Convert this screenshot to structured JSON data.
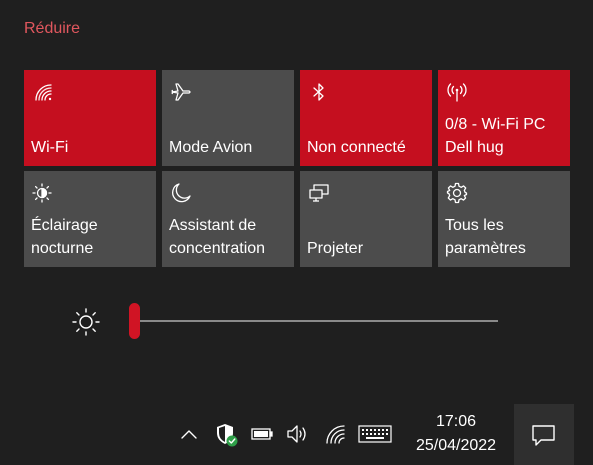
{
  "header": {
    "collapse_label": "Réduire"
  },
  "tiles": [
    {
      "label": "Wi-Fi",
      "icon": "wifi-icon",
      "active": true
    },
    {
      "label": "Mode Avion",
      "icon": "airplane-icon",
      "active": false
    },
    {
      "label": "Non connecté",
      "icon": "bluetooth-icon",
      "active": true
    },
    {
      "label": "0/8 - Wi-Fi PC\nDell hug",
      "icon": "hotspot-icon",
      "active": true
    },
    {
      "label": "Éclairage\nnocturne",
      "icon": "night-light-icon",
      "active": false
    },
    {
      "label": "Assistant de\nconcentration",
      "icon": "moon-icon",
      "active": false
    },
    {
      "label": "Projeter",
      "icon": "project-icon",
      "active": false
    },
    {
      "label": "Tous les\nparamètres",
      "icon": "gear-icon",
      "active": false
    }
  ],
  "brightness": {
    "icon": "sun-icon",
    "level_percent": 1
  },
  "taskbar": {
    "tray_icons": [
      "chevron-up-icon",
      "security-shield-icon",
      "battery-icon",
      "volume-icon",
      "wifi-icon",
      "keyboard-icon"
    ],
    "time": "17:06",
    "date": "25/04/2022",
    "notification_icon": "notification-icon"
  },
  "colors": {
    "accent": "#c50f1f",
    "tile_inactive": "#4c4c4c",
    "background": "#1f1f1f",
    "collapse_text": "#e0575e"
  }
}
